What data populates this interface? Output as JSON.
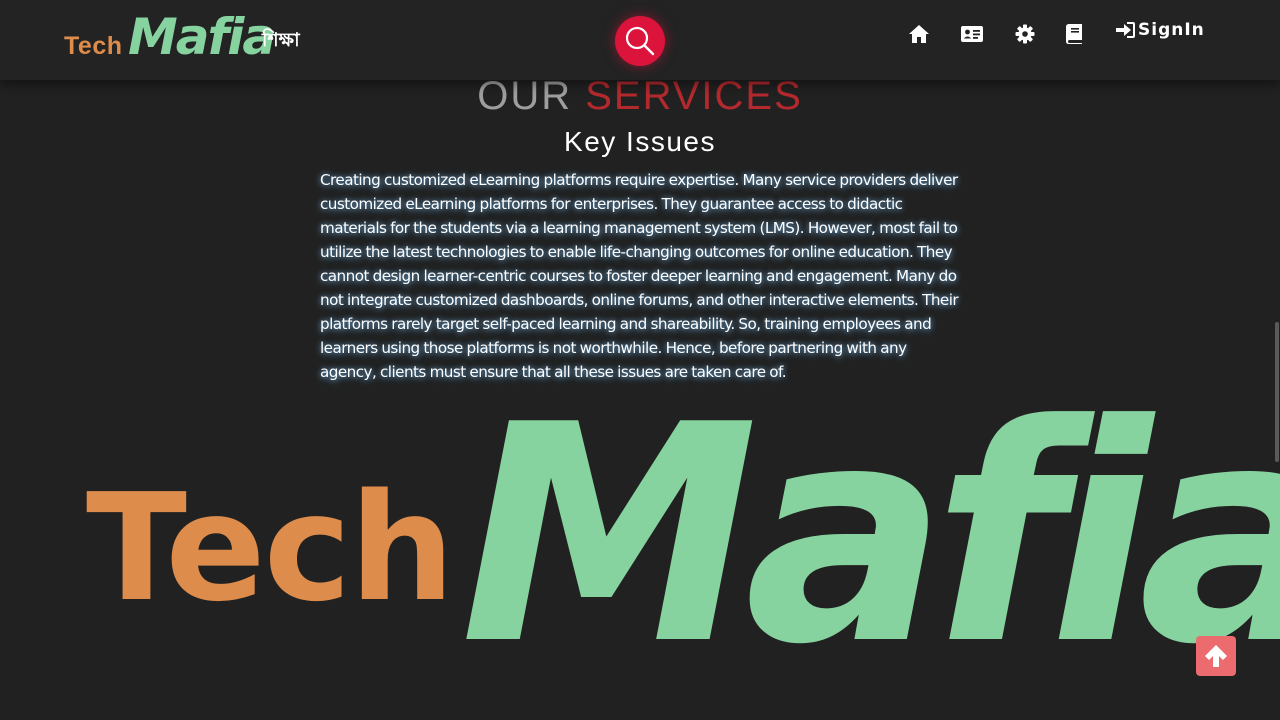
{
  "brand": {
    "tech": "Tech",
    "mafia": "Mafia",
    "tagline": "শিক্ষা"
  },
  "nav": {
    "search_icon": "search-icon",
    "items": [
      {
        "icon": "home-icon"
      },
      {
        "icon": "id-card-icon"
      },
      {
        "icon": "gear-icon"
      },
      {
        "icon": "book-icon"
      }
    ],
    "signin": {
      "icon": "sign-in-icon",
      "label": "SignIn"
    }
  },
  "services": {
    "title_part1": "OUR",
    "title_part2": "SERVICES",
    "subtitle": "Key Issues",
    "body": "Creating customized eLearning platforms require expertise. Many service providers deliver customized eLearning platforms for enterprises. They guarantee access to didactic materials for the students via a learning management system (LMS). However, most fail to utilize the latest technologies to enable life-changing outcomes for online education. They cannot design learner-centric courses to foster deeper learning and engagement. Many do not integrate customized dashboards, online forums, and other interactive elements. Their platforms rarely target self-paced learning and shareability. So, training employees and learners using those platforms is not worthwhile. Hence, before partnering with any agency, clients must ensure that all these issues are taken care of."
  },
  "big_logo": {
    "tech": "Tech",
    "mafia": "Mafia"
  },
  "colors": {
    "background": "#212121",
    "navbar": "#232323",
    "search_button": "#dc143c",
    "tech_orange": "#de8c4b",
    "mafia_green": "#86d39f",
    "title_grey": "#9e9e9e",
    "title_red": "#b3292e",
    "back_to_top": "#ec6b6e"
  },
  "back_to_top": {
    "icon": "arrow-up-icon"
  }
}
